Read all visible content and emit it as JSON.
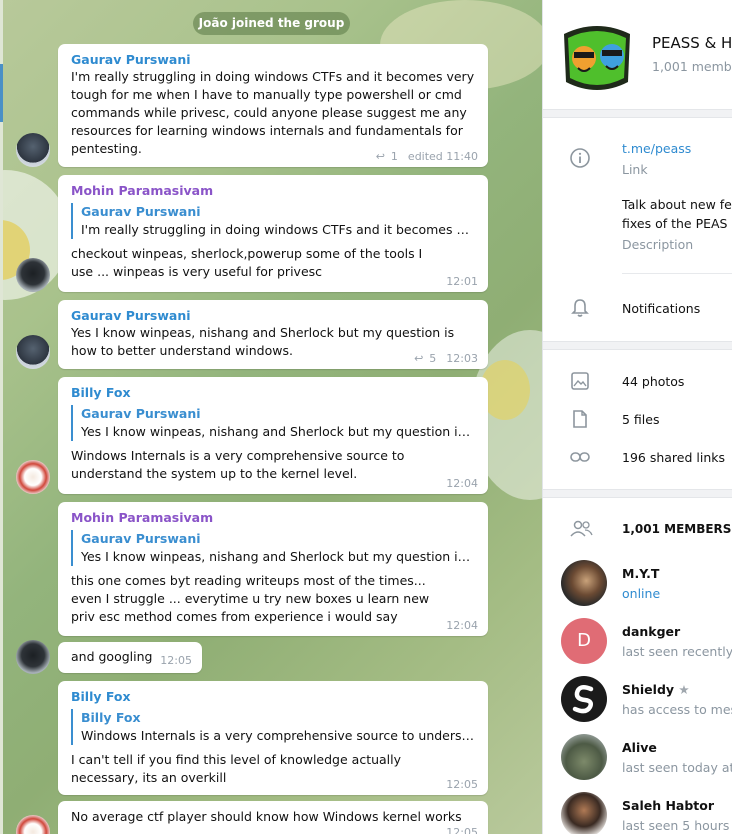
{
  "chat": {
    "service_message": "João joined the group",
    "messages": [
      {
        "author": "Gaurav Purswani",
        "text": "I'm really struggling in doing windows CTFs and it becomes very tough for me when I have to manually type powershell or cmd commands while privesc, could anyone please suggest me any resources for learning windows internals and fundamentals for pentesting.",
        "replies": "1",
        "time": "edited 11:40"
      },
      {
        "author": "Mohin Paramasivam",
        "reply_author": "Gaurav Purswani",
        "reply_text": "I'm really struggling in doing windows CTFs and it becomes very t...",
        "text": "checkout winpeas, sherlock,powerup  some of the tools I use ... winpeas is very useful for privesc",
        "time": "12:01"
      },
      {
        "author": "Gaurav Purswani",
        "text": "Yes I know winpeas, nishang and Sherlock but my question is how to better understand windows.",
        "replies": "5",
        "time": "12:03"
      },
      {
        "author": "Billy Fox",
        "reply_author": "Gaurav Purswani",
        "reply_text": "Yes I know winpeas, nishang and Sherlock but my question is ho...",
        "text": "Windows Internals is a very comprehensive source to understand the system up to the kernel level.",
        "time": "12:04"
      },
      {
        "author": "Mohin Paramasivam",
        "reply_author": "Gaurav Purswani",
        "reply_text": "Yes I know winpeas, nishang and Sherlock but my question is ho...",
        "text": "this one comes byt reading writeups most of the times... even I struggle ... everytime u try new boxes u learn new priv esc method comes from experience i would say",
        "time": "12:04"
      },
      {
        "text": "and googling",
        "time": "12:05"
      },
      {
        "author": "Billy Fox",
        "reply_author": "Billy Fox",
        "reply_text": "Windows Internals is a very comprehensive source to understan...",
        "text": "I can't tell if you find this level of knowledge actually necessary, its an overkill",
        "time": "12:05"
      },
      {
        "text": "No average ctf player should know how Windows kernel works",
        "time": "12:05"
      }
    ]
  },
  "panel": {
    "group_name": "PEASS & H",
    "members_count": "1,001 membe",
    "link": "t.me/peass",
    "link_label": "Link",
    "description_line1": "Talk about new fea",
    "description_line2": "fixes of the PEAS S",
    "description_label": "Description",
    "notifications": "Notifications",
    "photos": "44 photos",
    "files": "5 files",
    "links": "196 shared links",
    "members_header": "1,001 MEMBERS",
    "members": [
      {
        "name": "M.Y.T",
        "status": "online"
      },
      {
        "name": "dankger",
        "status": "last seen recently",
        "initial": "D"
      },
      {
        "name": "Shieldy",
        "status": "has access to mess",
        "star": "★"
      },
      {
        "name": "Alive",
        "status": "last seen today at 1"
      },
      {
        "name": "Saleh Habtor",
        "status": "last seen 5 hours a"
      }
    ]
  },
  "colors": {
    "accent": "#2f8bd0",
    "author_blue": "#2f8bd0",
    "author_purple": "#8a54c8",
    "dankger_avatar": "#e06c75"
  }
}
